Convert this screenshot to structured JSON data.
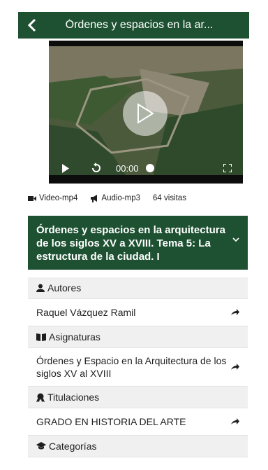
{
  "header": {
    "title": "Órdenes y espacios en la ar...",
    "back_icon": "chevron-left-icon",
    "color": "#1e5132"
  },
  "video": {
    "time": "00:00",
    "progress": 0.0
  },
  "meta": {
    "video_label": "Video-mp4",
    "audio_label": "Audio-mp3",
    "visits": "64 visitas"
  },
  "accordion": {
    "title": "Órdenes y espacios en la arquitectura de los siglos XV a XVIII. Tema 5: La estructura de la ciudad. I",
    "icon": "chevron-down-icon"
  },
  "sections": {
    "autores": {
      "header": "Autores",
      "icon": "user-icon",
      "item": "Raquel Vázquez Ramil"
    },
    "asignaturas": {
      "header": "Asignaturas",
      "icon": "book-icon",
      "item": "Órdenes y Espacio en la Arquitectura de los siglos XV al XVIII"
    },
    "titulaciones": {
      "header": "Titulaciones",
      "icon": "award-icon",
      "item": "GRADO EN HISTORIA DEL ARTE"
    },
    "categorias": {
      "header": "Categorías",
      "icon": "graduation-cap-icon"
    }
  }
}
